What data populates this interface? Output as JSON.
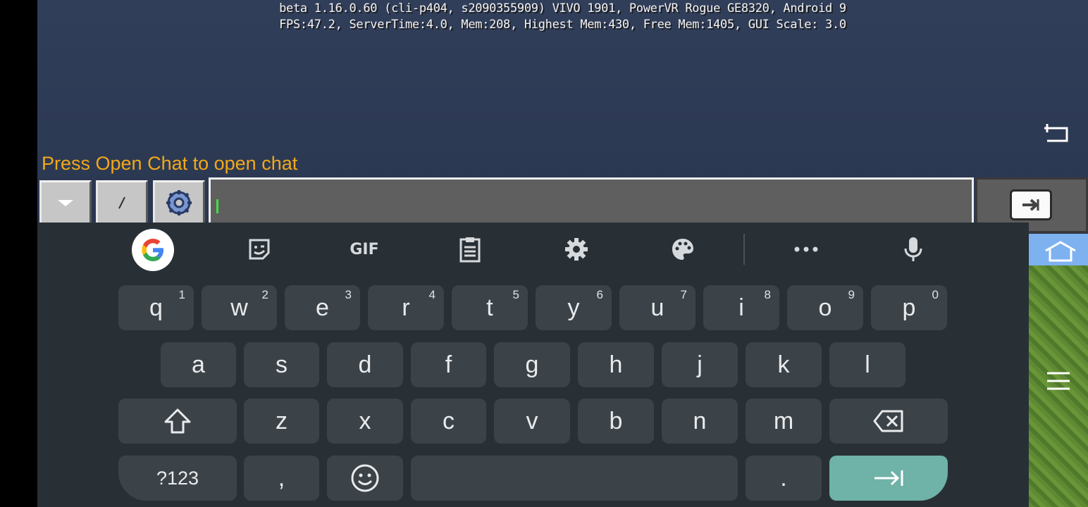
{
  "debug": {
    "line1": "beta 1.16.0.60 (cli-p404, s2090355909) VIVO 1901, PowerVR Rogue GE8320, Android 9",
    "line2": "FPS:47.2, ServerTime:4.0, Mem:208, Highest Mem:430, Free Mem:1405, GUI Scale: 3.0"
  },
  "chat": {
    "hint": "Press Open Chat to open chat",
    "input_value": ""
  },
  "keyboard": {
    "toolbar": [
      "google-search",
      "sticker",
      "GIF",
      "clipboard",
      "settings",
      "theme",
      "more",
      "voice"
    ],
    "gif_label": "GIF",
    "row1": [
      {
        "k": "q",
        "h": "1"
      },
      {
        "k": "w",
        "h": "2"
      },
      {
        "k": "e",
        "h": "3"
      },
      {
        "k": "r",
        "h": "4"
      },
      {
        "k": "t",
        "h": "5"
      },
      {
        "k": "y",
        "h": "6"
      },
      {
        "k": "u",
        "h": "7"
      },
      {
        "k": "i",
        "h": "8"
      },
      {
        "k": "o",
        "h": "9"
      },
      {
        "k": "p",
        "h": "0"
      }
    ],
    "row2": [
      "a",
      "s",
      "d",
      "f",
      "g",
      "h",
      "j",
      "k",
      "l"
    ],
    "row3": [
      "z",
      "x",
      "c",
      "v",
      "b",
      "n",
      "m"
    ],
    "sym_label": "?123",
    "comma": ",",
    "period": "."
  }
}
